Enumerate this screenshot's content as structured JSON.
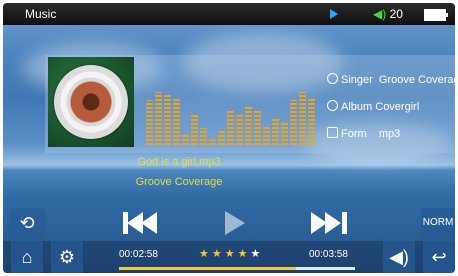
{
  "status_bar": {
    "title": "Music",
    "volume": "20"
  },
  "track": {
    "singer_label": "Singer",
    "singer": "Groove Coverage",
    "album_label": "Album",
    "album": "Covergirl",
    "form_label": "Form",
    "form": "mp3",
    "filename": "God is a girl.mp3",
    "artist_line": "Groove Coverage"
  },
  "playback": {
    "elapsed": "00:02:58",
    "total": "00:03:58",
    "progress_fraction": 0.75,
    "rating": 4,
    "rating_max": 5,
    "eq_mode": "NORM"
  },
  "equalizer": {
    "levels": [
      0.8,
      0.95,
      0.9,
      0.85,
      0.2,
      0.55,
      0.3,
      0.15,
      0.25,
      0.6,
      0.55,
      0.7,
      0.65,
      0.35,
      0.5,
      0.4,
      0.8,
      0.95,
      0.85
    ]
  },
  "icons": {
    "repeat": "repeat-icon",
    "prev": "previous-icon",
    "play": "play-icon",
    "next": "next-icon",
    "home": "home-icon",
    "settings": "gear-icon",
    "speaker": "speaker-icon",
    "back": "back-icon",
    "bluetooth": "bluetooth-icon",
    "battery": "battery-icon"
  },
  "colors": {
    "accent": "#f4c542",
    "song_text": "#e6df3c",
    "eq": "#f0a318"
  }
}
